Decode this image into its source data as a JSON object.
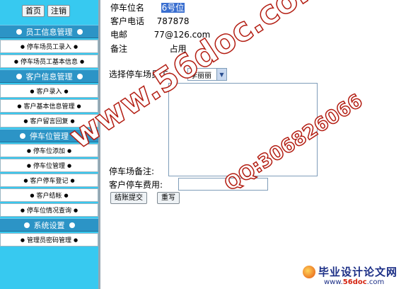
{
  "top_buttons": {
    "home": "首页",
    "logout": "注销"
  },
  "sidebar": {
    "sections": [
      {
        "title": "员工信息管理",
        "items": [
          "停车场员工录入",
          "停车场员工基本信息"
        ]
      },
      {
        "title": "客户信息管理",
        "items": [
          "客户录入",
          "客户基本信息管理",
          "客户留言回复"
        ]
      },
      {
        "title": "停车位管理",
        "items": [
          "停车位添加",
          "停车位管理",
          "客户停车登记",
          "客户结帐",
          "停车位情况查询"
        ]
      },
      {
        "title": "系统设置",
        "items": [
          "管理员密码管理"
        ]
      }
    ]
  },
  "info": {
    "space_label": "停车位名",
    "space_value": "6号位",
    "phone_label": "客户电话",
    "phone_value": "787878",
    "email_label": "电邮",
    "email_value": "77@126.com",
    "note_label": "备注",
    "note_value": "占用"
  },
  "form": {
    "staff_label": "选择停车场员工:",
    "staff_selected": "李丽丽",
    "remark_label": "停车场备注:",
    "remark_value": "",
    "fee_label": "客户停车费用:",
    "fee_value": "",
    "submit_label": "结账提交",
    "reset_label": "重写"
  },
  "watermark": {
    "site": "www.56doc.com",
    "qq": "QQ:306826066"
  },
  "logo": {
    "title": "毕业设计论文网",
    "url_prefix": "www.",
    "url_brand": "56doc",
    "url_suffix": ".com"
  },
  "colors": {
    "sidebar_bg": "#37c9f0",
    "section_bg": "#2c94c6",
    "watermark_stroke": "#b31d12"
  }
}
